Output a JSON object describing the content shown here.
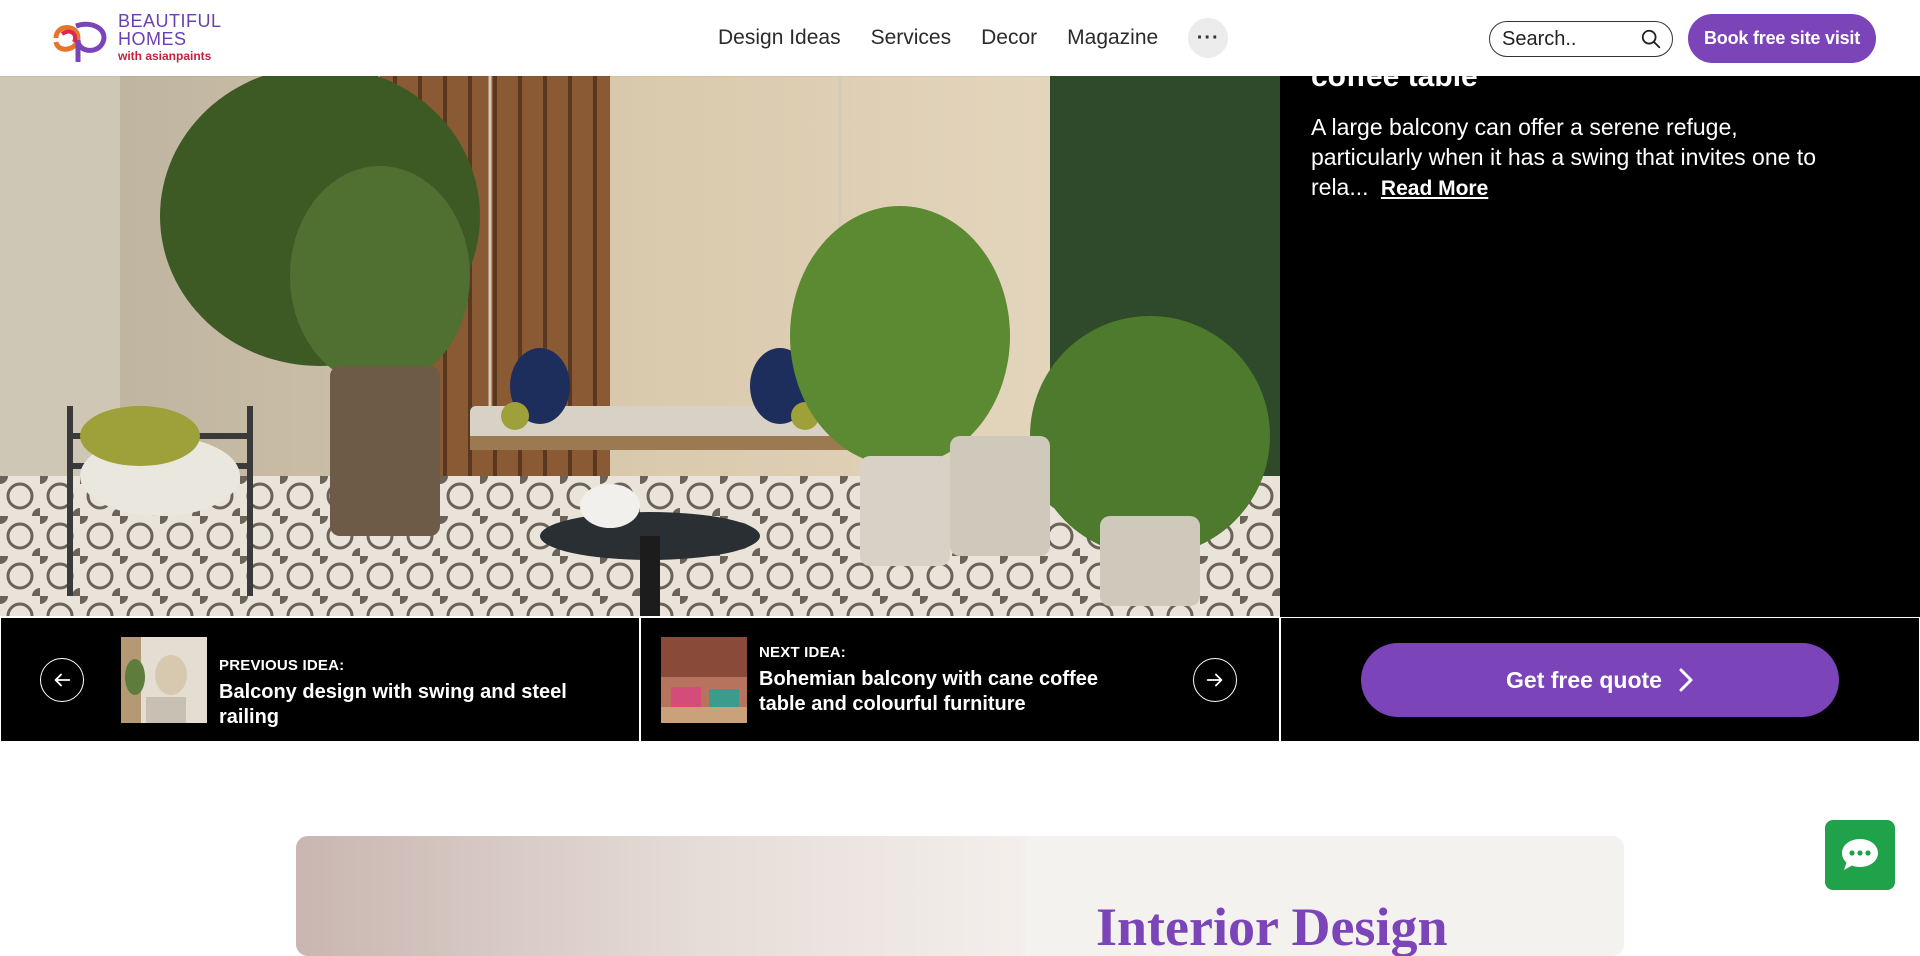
{
  "header": {
    "logo": {
      "line1": "BEAUTIFUL",
      "line2": "HOMES",
      "line3": "with asianpaints"
    },
    "nav": [
      {
        "label": "Design Ideas"
      },
      {
        "label": "Services"
      },
      {
        "label": "Decor"
      },
      {
        "label": "Magazine"
      }
    ],
    "more_label": "···",
    "search": {
      "placeholder": "Search.."
    },
    "cta_label": "Book free site visit"
  },
  "hero": {
    "title": "coffee table",
    "description": "A large balcony can offer a serene refuge, particularly when it has a swing that invites one to rela...",
    "read_more": "Read More"
  },
  "navigation": {
    "previous": {
      "kicker": "PREVIOUS IDEA:",
      "title": "Balcony design with swing and steel railing"
    },
    "next": {
      "kicker": "NEXT IDEA:",
      "title": "Bohemian balcony with cane coffee table and colourful furniture"
    },
    "quote_label": "Get free quote"
  },
  "lower": {
    "heading": "Interior Design"
  },
  "colors": {
    "brand_purple": "#7b44b8",
    "chat_green": "#1fa24a",
    "black": "#000000"
  },
  "icons": [
    "search-icon",
    "arrow-left-icon",
    "arrow-right-icon",
    "chevron-right-icon",
    "chat-icon",
    "more-icon"
  ]
}
